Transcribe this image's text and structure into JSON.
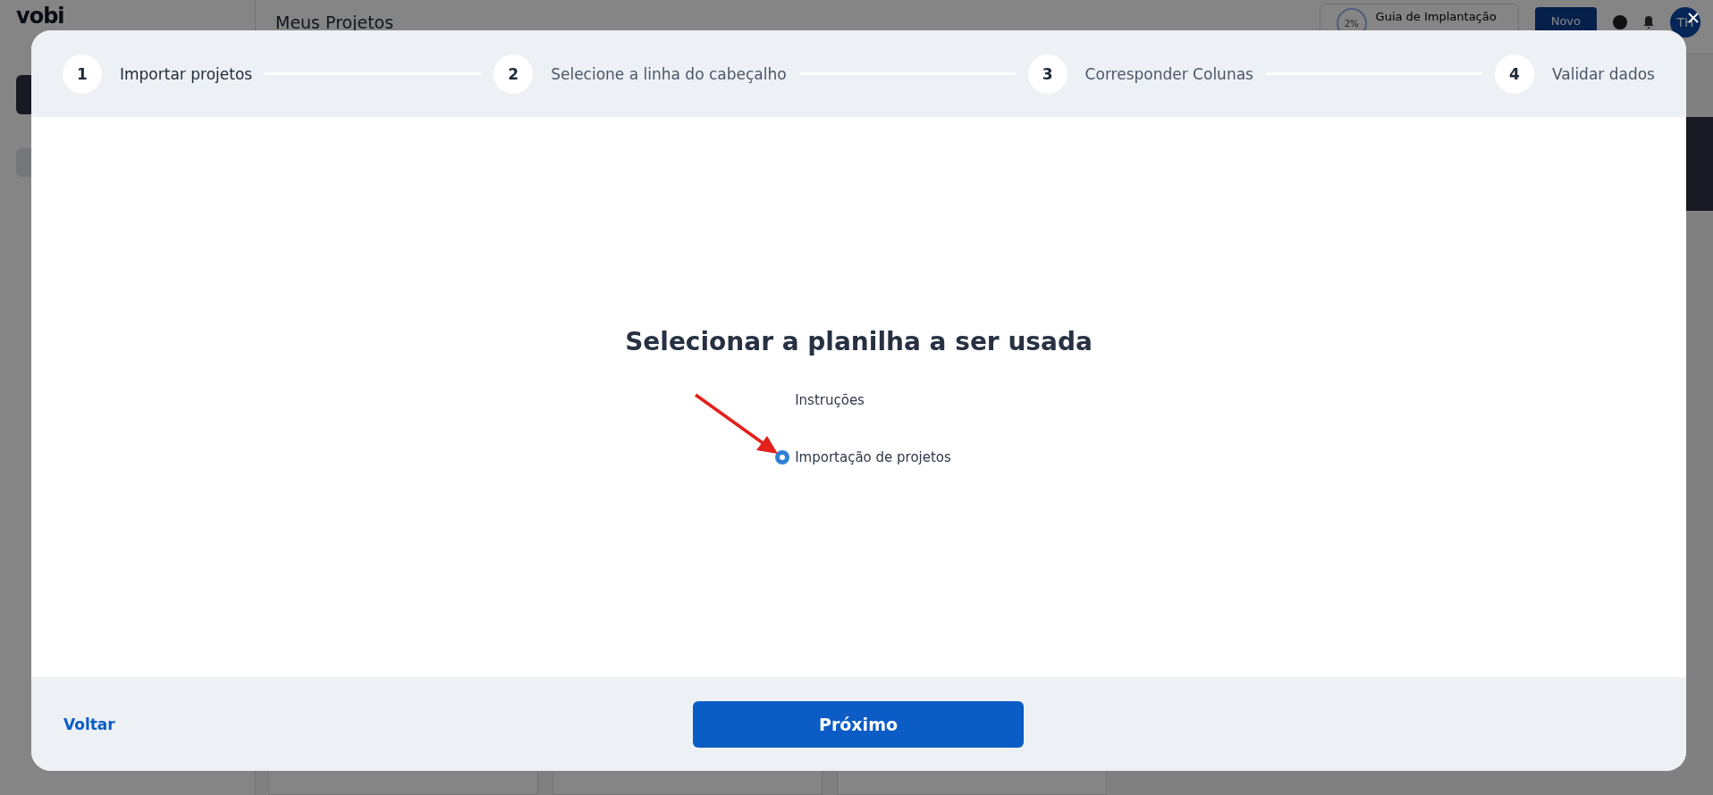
{
  "background": {
    "logo": "vobi",
    "page_title": "Meus Projetos",
    "guide": {
      "percent": "2%",
      "label": "Guia de Implantação"
    },
    "new_button": "Novo",
    "avatar": "TH"
  },
  "dialog": {
    "steps": [
      {
        "number": "1",
        "label": "Importar projetos",
        "active": true
      },
      {
        "number": "2",
        "label": "Selecione a linha do cabeçalho",
        "active": false
      },
      {
        "number": "3",
        "label": "Corresponder Colunas",
        "active": false
      },
      {
        "number": "4",
        "label": "Validar dados",
        "active": false
      }
    ],
    "title": "Selecionar a planilha a ser usada",
    "options": [
      {
        "label": "Instruções",
        "selected": false
      },
      {
        "label": "Importação de projetos",
        "selected": true
      }
    ],
    "back": "Voltar",
    "next": "Próximo"
  }
}
